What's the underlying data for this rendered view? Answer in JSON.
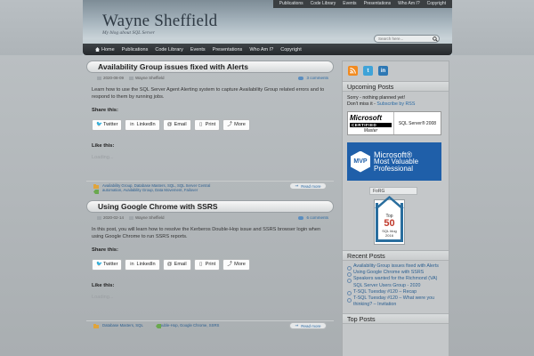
{
  "header": {
    "site_title": "Wayne Sheffield",
    "site_description": "My blog about SQL Server",
    "top_links": [
      "Publications",
      "Code Library",
      "Events",
      "Presentations",
      "Who Am I?",
      "Copyright"
    ],
    "search_placeholder": "Search here..."
  },
  "nav": {
    "items": [
      "Home",
      "Publications",
      "Code Library",
      "Events",
      "Presentations",
      "Who Am I?",
      "Copyright"
    ]
  },
  "posts": [
    {
      "title": "Availability Group issues fixed with Alerts",
      "date": "2020-08-09",
      "author": "Wayne Sheffield",
      "comments": "3 comments",
      "body": "Learn how to use the SQL Server Agent Alerting system to capture Availability Group related errors and to respond to them by running jobs.",
      "share_label": "Share this:",
      "share_buttons": [
        "Twitter",
        "LinkedIn",
        "Email",
        "Print",
        "More"
      ],
      "like_label": "Like this:",
      "loading": "Loading...",
      "categories": "Availability Group, Database Masters, SQL, SQL Server Central",
      "tags": "automation, Availability Group, Data Movement, Failover",
      "read_more": "Read more"
    },
    {
      "title": "Using Google Chrome with SSRS",
      "date": "2020-02-14",
      "author": "Wayne Sheffield",
      "comments": "6 comments",
      "body": "In this post, you will learn how to resolve the Kerberos Double-Hop issue and SSRS browser login when using Google Chrome to run SSRS reports.",
      "share_label": "Share this:",
      "share_buttons": [
        "Twitter",
        "LinkedIn",
        "Email",
        "Print",
        "More"
      ],
      "like_label": "Like this:",
      "loading": "Loading...",
      "categories": "Database Masters, SQL",
      "tags": "Double-Hop, Google Chrome, SSRS",
      "read_more": "Read more"
    }
  ],
  "sidebar": {
    "upcoming_title": "Upcoming Posts",
    "upcoming_line1": "Sorry - nothing planned yet!",
    "upcoming_line2_prefix": "Don't miss it - ",
    "upcoming_line2_link": "Subscribe by RSS",
    "ms_certified_top": "Microsoft",
    "ms_certified_band": "CERTIFIED",
    "ms_certified_level": "Master",
    "ms_certified_product": "SQL Server® 2008",
    "mvp_badge": "MVP",
    "mvp_line1": "Microsoft®",
    "mvp_line2": "Most Valuable",
    "mvp_line3": "Professional",
    "forg": "FoRG",
    "top50_1": "Top",
    "top50_2": "50",
    "top50_3": "SQL blog",
    "top50_4": "2016",
    "recent_title": "Recent Posts",
    "recent_posts": [
      "Availability Group issues fixed with Alerts",
      "Using Google Chrome with SSRS",
      "Speakers wanted for the Richmond (VA) SQL Server Users Group - 2020",
      "T-SQL Tuesday #120 – Recap",
      "T-SQL Tuesday #120 – What were you thinking? – Invitation"
    ],
    "top_posts_title": "Top Posts"
  },
  "colors": {
    "rss": "#f28a1f",
    "twitter": "#3fa3d8",
    "linkedin": "#2e78b4",
    "mvp_blue": "#1f5fa9"
  },
  "icons": {
    "rss": "rss-icon",
    "twitter": "twitter-icon",
    "linkedin": "linkedin-icon"
  }
}
